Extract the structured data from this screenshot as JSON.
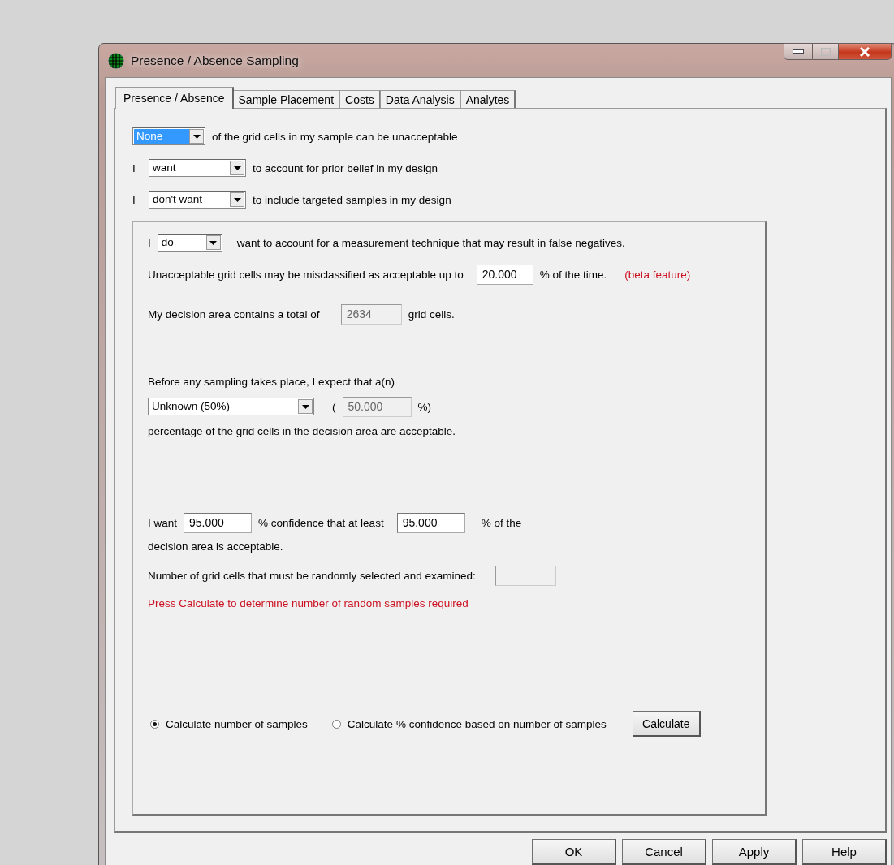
{
  "window": {
    "title": "Presence / Absence Sampling"
  },
  "tabs": [
    {
      "label": "Presence / Absence",
      "selected": true
    },
    {
      "label": "Sample Placement",
      "selected": false
    },
    {
      "label": "Costs",
      "selected": false
    },
    {
      "label": "Data Analysis",
      "selected": false
    },
    {
      "label": "Analytes",
      "selected": false
    }
  ],
  "top_rows": [
    {
      "dropdown": {
        "value": "None",
        "highlighted": true
      },
      "text": "of the grid cells in my sample can be unacceptable"
    },
    {
      "prefix": "I",
      "dropdown": {
        "value": "want",
        "highlighted": false
      },
      "text": "to account for prior belief in my design"
    },
    {
      "prefix": "I",
      "dropdown": {
        "value": "don't want",
        "highlighted": false
      },
      "text": "to include targeted samples in my design"
    }
  ],
  "false_negatives": {
    "prefix": "I",
    "dropdown": {
      "value": "do",
      "highlighted": false
    },
    "text": "want to account for a measurement technique that may result in false negatives."
  },
  "misclassification": {
    "label": "Unacceptable grid cells may be misclassified as acceptable up to",
    "field": {
      "value": "20.000",
      "disabled": false
    },
    "suffix": "% of the time.",
    "note": "(beta feature)"
  },
  "total": {
    "label": "My decision area contains a total of",
    "field": {
      "value": "2634",
      "disabled": true
    },
    "suffix": "grid cells."
  },
  "prior": {
    "label": "Before any sampling takes place, I expect that a(n)",
    "dropdown": {
      "value": "Unknown (50%)",
      "highlighted": false
    },
    "open": "(",
    "field": {
      "value": "50.000",
      "disabled": true
    },
    "close": "%)",
    "text": "percentage of the grid cells in the decision area are acceptable."
  },
  "confidence": {
    "prefix": "I want",
    "field_1": {
      "value": "95.000",
      "disabled": false
    },
    "middle": "% confidence that at least",
    "field_2": {
      "value": "95.000",
      "disabled": false
    },
    "suffix": "% of the",
    "line_2": "decision area is acceptable."
  },
  "result": {
    "label": "Number of grid cells that must be randomly selected and examined:",
    "field": {
      "disabled": true
    }
  },
  "message": "Press Calculate to determine number of random samples required",
  "modes": [
    {
      "label": "Calculate number of samples",
      "selected": true
    },
    {
      "label": "Calculate % confidence based on number of samples",
      "selected": false
    }
  ],
  "calculate_button": "Calculate",
  "buttons": [
    {
      "label": "OK"
    },
    {
      "label": "Cancel"
    },
    {
      "label": "Apply"
    },
    {
      "label": "Help"
    }
  ]
}
